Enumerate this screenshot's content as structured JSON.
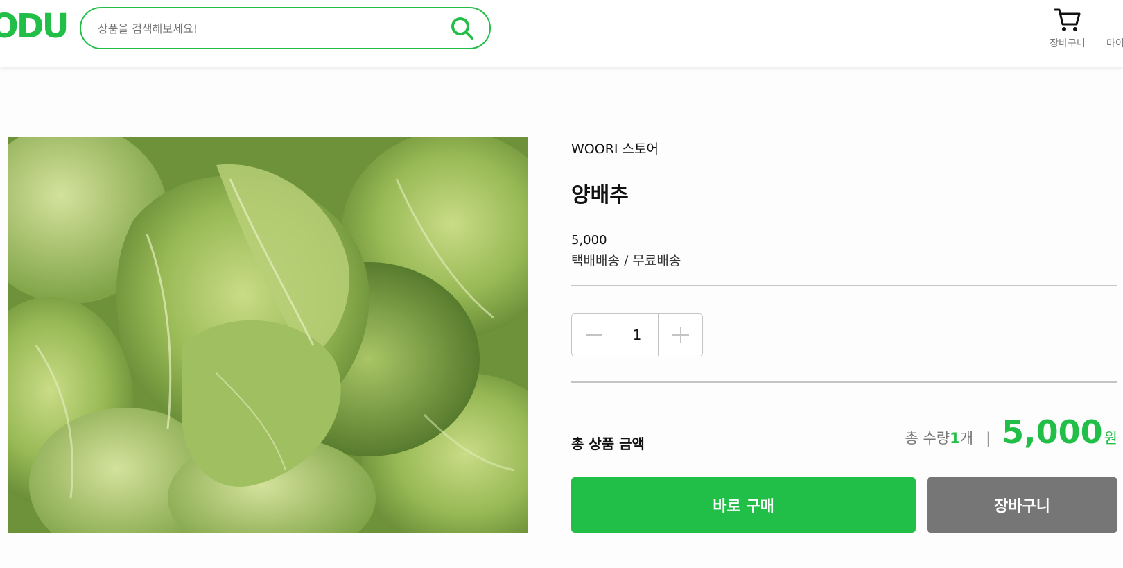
{
  "header": {
    "logo_text": "ODU",
    "search": {
      "placeholder": "상품을 검색해보세요!",
      "value": ""
    },
    "cart_label": "장바구니",
    "mypage_label": "마이페이지"
  },
  "product": {
    "image_alt": "양배추",
    "store": "WOORI 스토어",
    "name": "양배추",
    "price": "5,000",
    "shipping": "택배배송 / 무료배송",
    "quantity": "1",
    "total_label": "총 상품 금액",
    "total_count_prefix": "총 수량 ",
    "total_count": "1",
    "total_count_suffix": "개",
    "separator": "|",
    "total_price": "5,000",
    "currency": "원",
    "buy_label": "바로 구매",
    "cart_button_label": "장바구니"
  },
  "colors": {
    "accent": "#21bf48",
    "secondary_button": "#767676",
    "divider": "#c4c4c4"
  },
  "icons": [
    "search-icon",
    "cart-icon",
    "minus-icon",
    "plus-icon"
  ]
}
